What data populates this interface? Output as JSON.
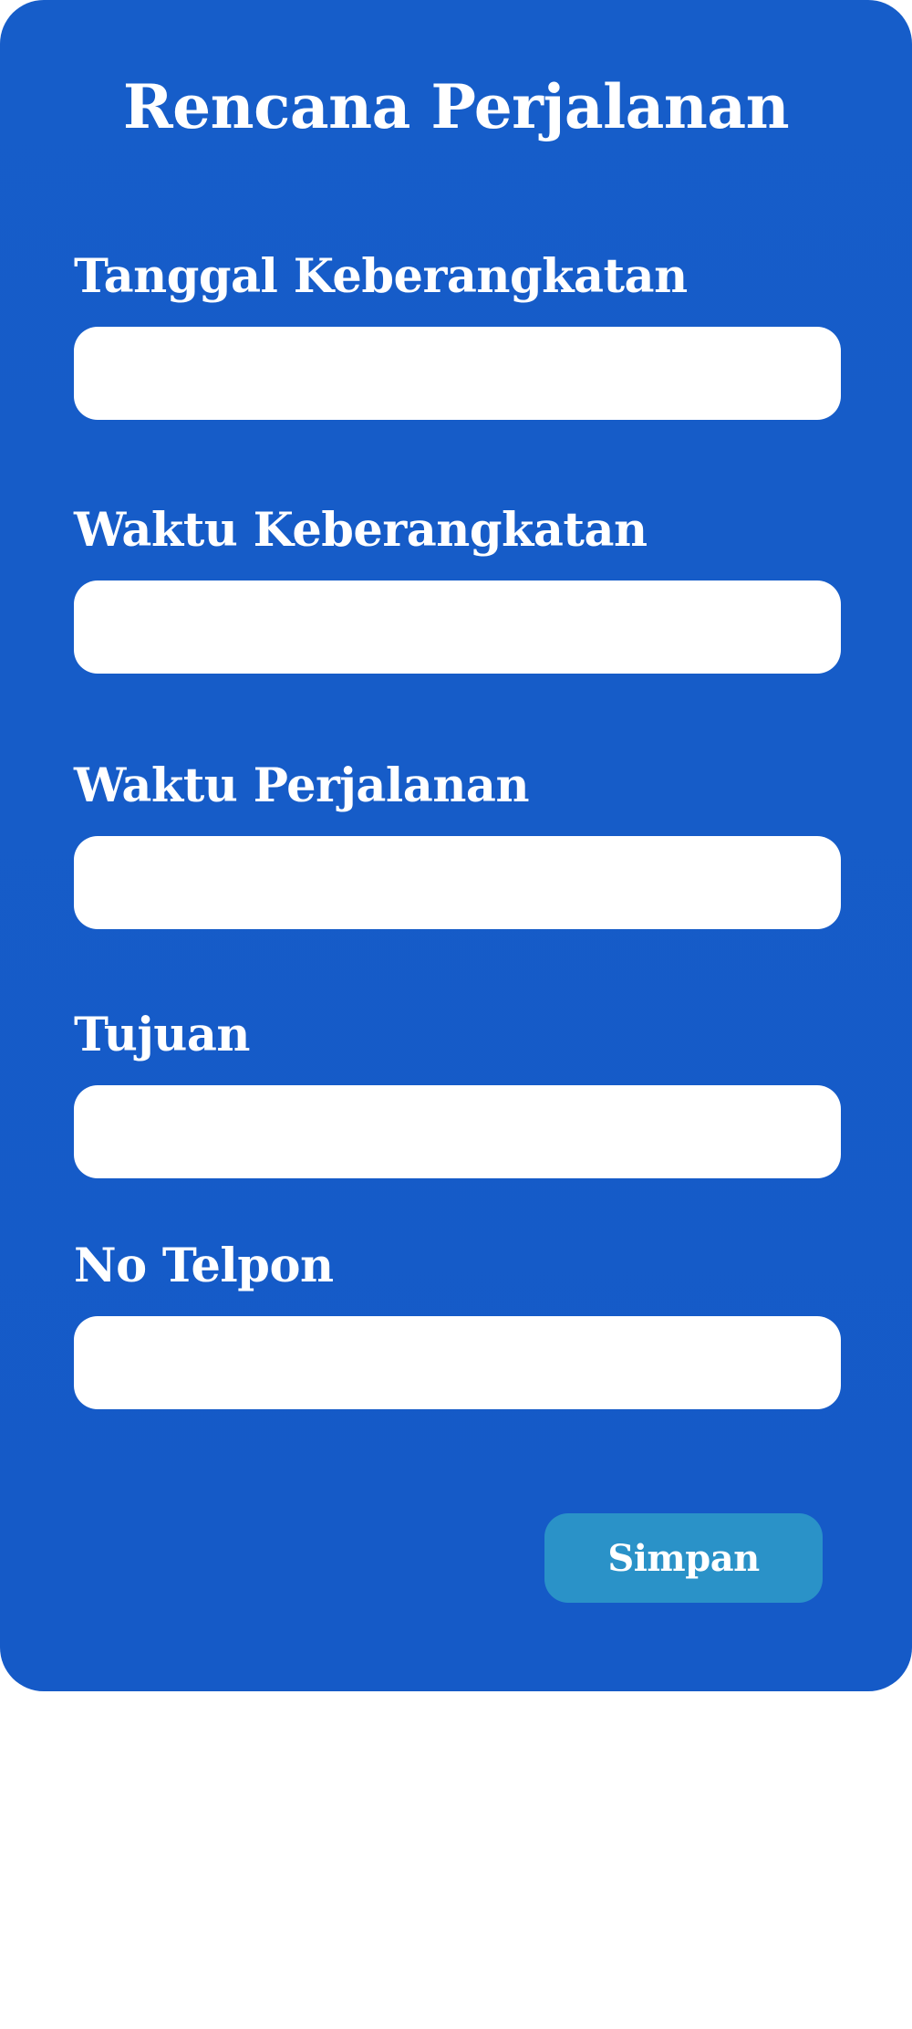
{
  "form": {
    "title": "Rencana Perjalanan",
    "fields": [
      {
        "label": "Tanggal Keberangkatan",
        "value": ""
      },
      {
        "label": "Waktu Keberangkatan",
        "value": ""
      },
      {
        "label": "Waktu Perjalanan",
        "value": ""
      },
      {
        "label": "Tujuan",
        "value": ""
      },
      {
        "label": "No Telpon",
        "value": ""
      }
    ],
    "save_label": "Simpan"
  },
  "colors": {
    "card_background": "#165dc9",
    "button_background": "#2a92c8",
    "text": "#ffffff",
    "field_background": "#ffffff"
  }
}
